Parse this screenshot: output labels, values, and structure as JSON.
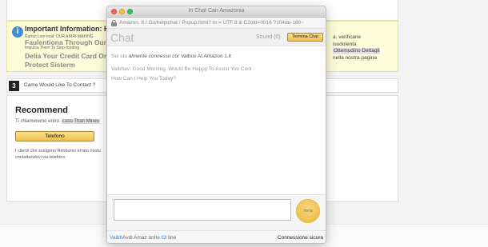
{
  "background": {
    "info_box": {
      "title": "Important Information: Hair",
      "line1": "Ramol Line-mail: OUR AIRRI MAKING",
      "big1": "Faulentiona Through Our Pro",
      "line3": "Impulsa Them To Stop-fooding",
      "big2": "Delia Your Credit Card Or",
      "big3": "Protect Sisterm",
      "right1": "a, verificane",
      "right2": "isudolenta",
      "right3": "Ottemudino Dettagli",
      "right4": "nella nostra pagina"
    },
    "step": {
      "number": "3",
      "label": "Came Would Like To Contact ?"
    },
    "recommend": {
      "title": "Recommend",
      "line_prefix": "Ti chiameremo entro:",
      "line_time": "Less Than Mines",
      "phone_button": "Telefono",
      "small1": "I clienti che scelgono Rimborso errato risolu",
      "small2": "contattandoci via telefono"
    }
  },
  "chat_window": {
    "title": "In Chat Can Amazonia",
    "url": "Amazon. It / Go/helpichat / Popup.html? In = UTF 8 & C2old=0016 ?104de-180~",
    "header_title": "Chat",
    "sound_label": "Sound (0)",
    "end_button": "Termina Chat",
    "messages": {
      "m1_prefix": "Sei sta",
      "m1_mid": "almente connesso cor",
      "m1_name": "Vaibuv At Amazon",
      "m1_suffix": "1.it",
      "m2": "Vaibhav: Good Morning. Would Be Happy To Assist You Cool",
      "m3": "How Can I Help You Today?"
    },
    "input_placeholder": "",
    "send_button": "Invia",
    "footer_left_1": "Vaibh",
    "footer_left_2": "Avdi Amaz",
    "footer_left_3": "on",
    "footer_left_4": "Ite Ol",
    "footer_left_5": "line",
    "footer_right": "Connessione sicura"
  },
  "colors": {
    "accent": "#f0c14b",
    "info_bg": "#fcfcd9",
    "info_icon": "#3f8fd2"
  }
}
